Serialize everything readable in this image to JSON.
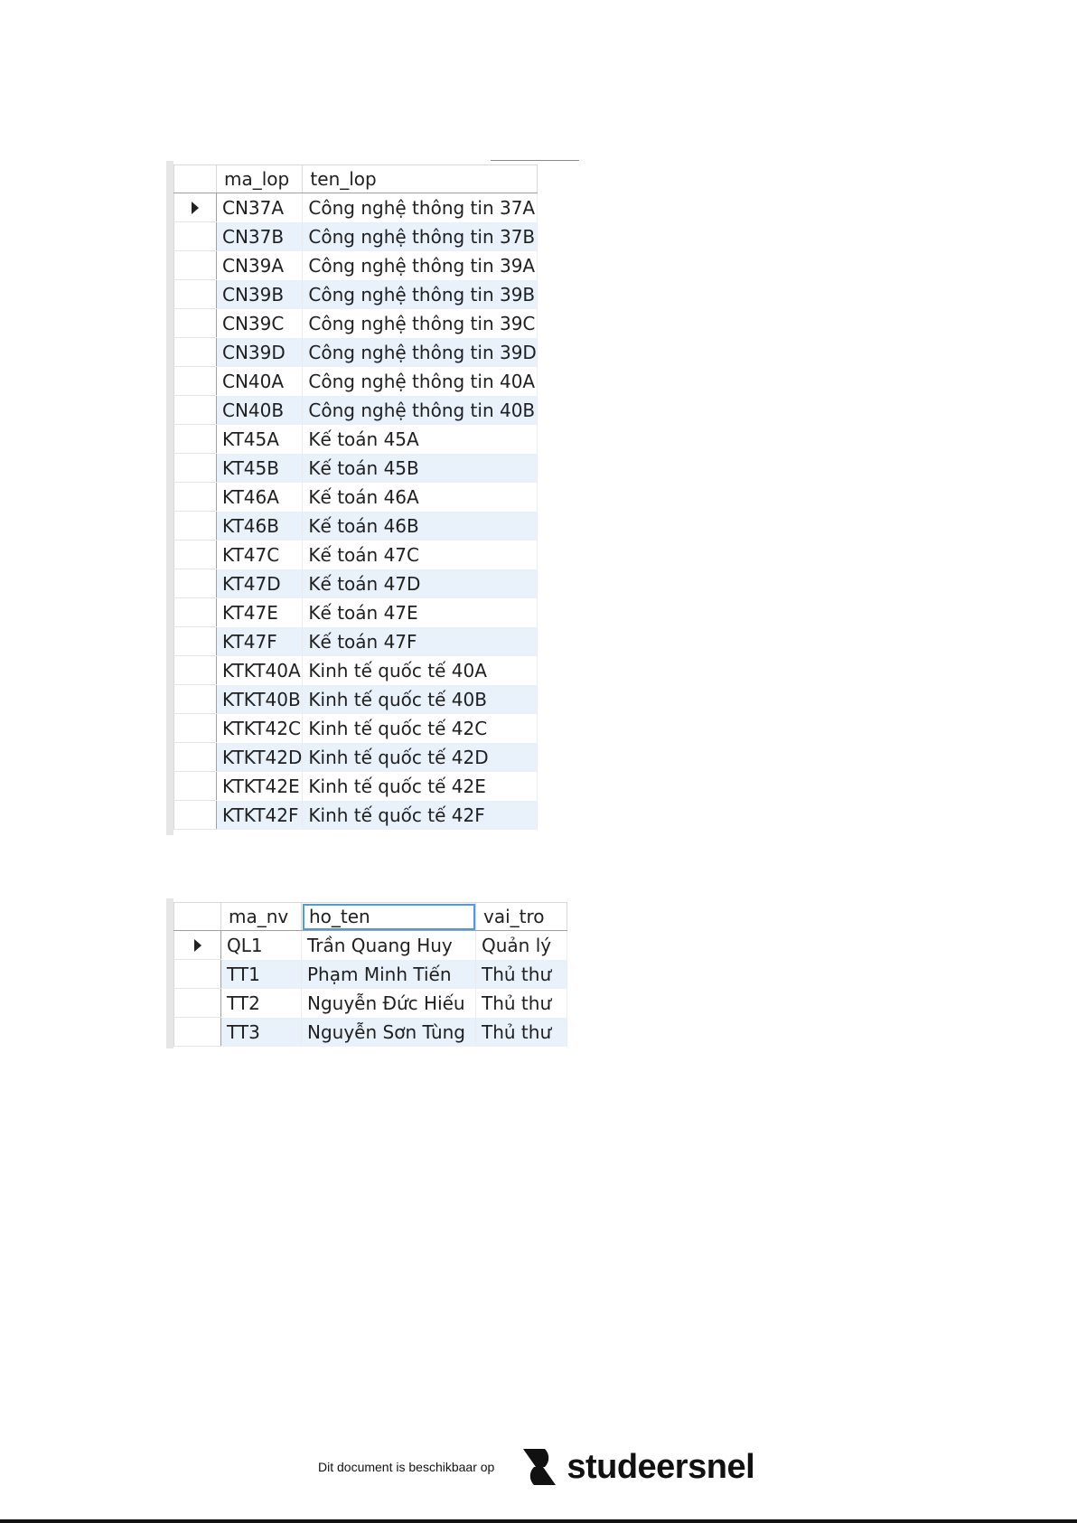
{
  "grid_classes": {
    "columns": [
      "ma_lop",
      "ten_lop"
    ],
    "rows": [
      [
        "CN37A",
        "Công nghệ thông tin 37A"
      ],
      [
        "CN37B",
        "Công nghệ thông tin 37B"
      ],
      [
        "CN39A",
        "Công nghệ thông tin 39A"
      ],
      [
        "CN39B",
        "Công nghệ thông tin 39B"
      ],
      [
        "CN39C",
        "Công nghệ thông tin 39C"
      ],
      [
        "CN39D",
        "Công nghệ thông tin 39D"
      ],
      [
        "CN40A",
        "Công nghệ thông tin 40A"
      ],
      [
        "CN40B",
        "Công nghệ thông tin 40B"
      ],
      [
        "KT45A",
        "Kế toán 45A"
      ],
      [
        "KT45B",
        "Kế toán 45B"
      ],
      [
        "KT46A",
        "Kế toán 46A"
      ],
      [
        "KT46B",
        "Kế toán 46B"
      ],
      [
        "KT47C",
        "Kế toán 47C"
      ],
      [
        "KT47D",
        "Kế toán 47D"
      ],
      [
        "KT47E",
        "Kế toán 47E"
      ],
      [
        "KT47F",
        "Kế toán 47F"
      ],
      [
        "KTKT40A",
        "Kinh tế quốc tế 40A"
      ],
      [
        "KTKT40B",
        "Kinh tế quốc tế 40B"
      ],
      [
        "KTKT42C",
        "Kinh tế quốc tế 42C"
      ],
      [
        "KTKT42D",
        "Kinh tế quốc tế 42D"
      ],
      [
        "KTKT42E",
        "Kinh tế quốc tế 42E"
      ],
      [
        "KTKT42F",
        "Kinh tế quốc tế 42F"
      ]
    ]
  },
  "grid_staff": {
    "columns": [
      "ma_nv",
      "ho_ten",
      "vai_tro"
    ],
    "rows": [
      [
        "QL1",
        "Trần Quang Huy",
        "Quản lý"
      ],
      [
        "TT1",
        "Phạm Minh Tiến",
        "Thủ thư"
      ],
      [
        "TT2",
        "Nguyễn Đức Hiếu",
        "Thủ thư"
      ],
      [
        "TT3",
        "Nguyễn Sơn Tùng",
        "Thủ thư"
      ]
    ]
  },
  "footer": {
    "text": "Dit document is beschikbaar op",
    "brand": "studeersnel"
  },
  "colors": {
    "alt_row": "#e9f1fb",
    "header_focus": "#4d9be6"
  }
}
